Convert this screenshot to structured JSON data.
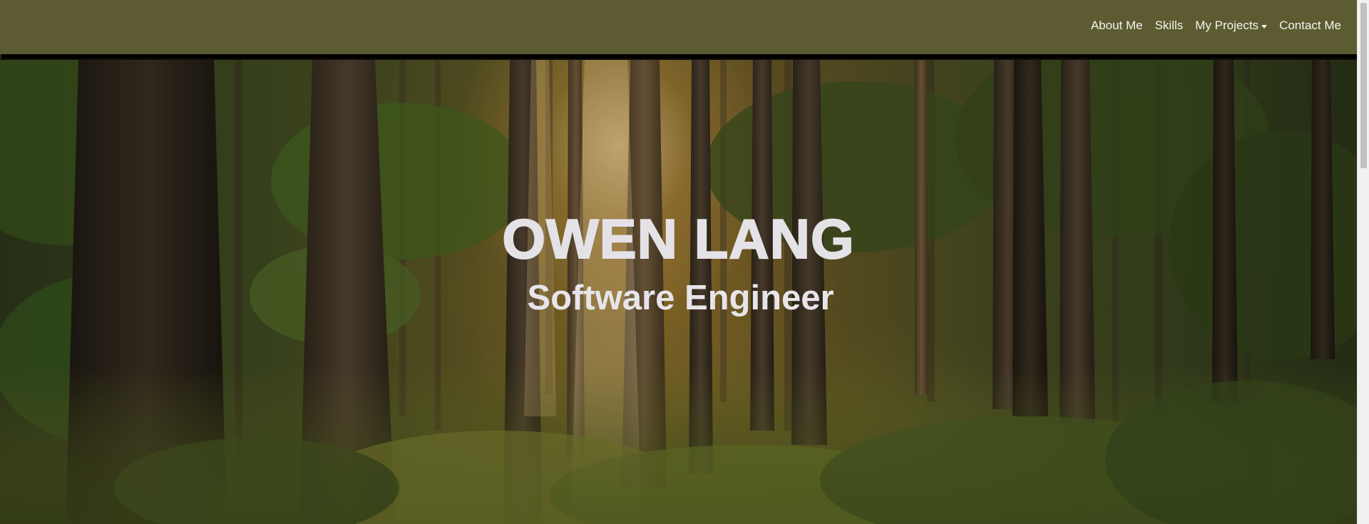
{
  "nav": {
    "items": [
      {
        "label": "About Me",
        "dropdown": false
      },
      {
        "label": "Skills",
        "dropdown": false
      },
      {
        "label": "My Projects",
        "dropdown": true
      },
      {
        "label": "Contact Me",
        "dropdown": false
      }
    ]
  },
  "hero": {
    "title": "OWEN LANG",
    "subtitle": "Software Engineer",
    "background": "forest-photo"
  },
  "colors": {
    "navbar": "#5c5b31",
    "hero_text": "#e4e2e6",
    "nav_text": "#f4f4f0"
  }
}
